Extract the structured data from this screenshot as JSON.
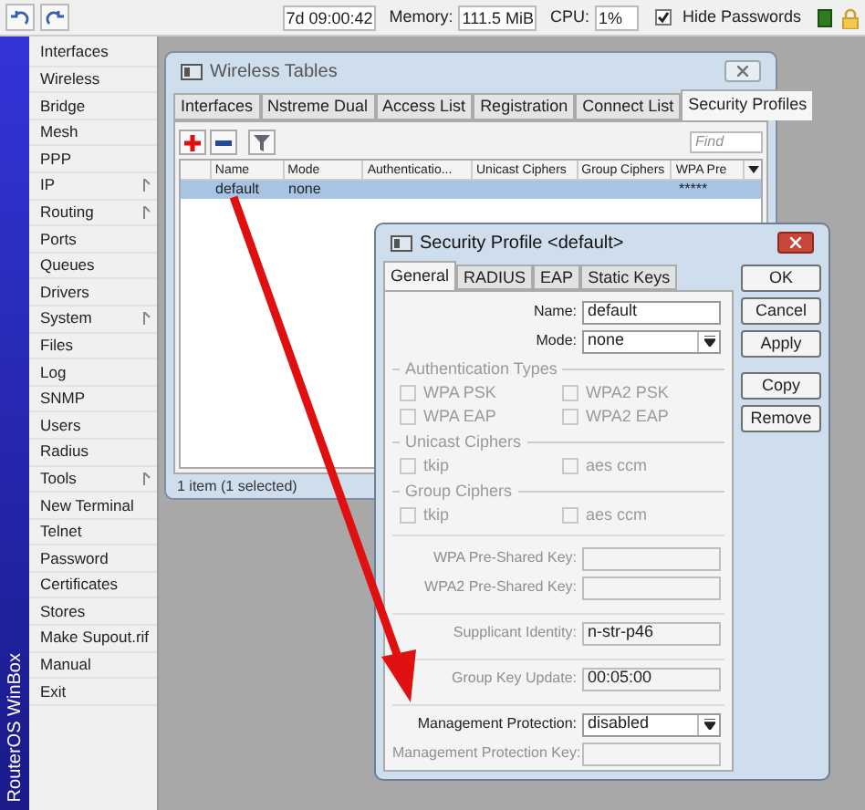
{
  "toolbar": {
    "uptime": "7d 09:00:42",
    "memory_label": "Memory:",
    "memory": "111.5 MiB",
    "cpu_label": "CPU:",
    "cpu": "1%",
    "hide_passwords": {
      "label": "Hide Passwords",
      "checked": true
    }
  },
  "sidebar": {
    "brand": "RouterOS WinBox",
    "items": [
      {
        "label": "Interfaces",
        "submenu": false
      },
      {
        "label": "Wireless",
        "submenu": false
      },
      {
        "label": "Bridge",
        "submenu": false
      },
      {
        "label": "Mesh",
        "submenu": false
      },
      {
        "label": "PPP",
        "submenu": false
      },
      {
        "label": "IP",
        "submenu": true
      },
      {
        "label": "Routing",
        "submenu": true
      },
      {
        "label": "Ports",
        "submenu": false
      },
      {
        "label": "Queues",
        "submenu": false
      },
      {
        "label": "Drivers",
        "submenu": false
      },
      {
        "label": "System",
        "submenu": true
      },
      {
        "label": "Files",
        "submenu": false
      },
      {
        "label": "Log",
        "submenu": false
      },
      {
        "label": "SNMP",
        "submenu": false
      },
      {
        "label": "Users",
        "submenu": false
      },
      {
        "label": "Radius",
        "submenu": false
      },
      {
        "label": "Tools",
        "submenu": true
      },
      {
        "label": "New Terminal",
        "submenu": false
      },
      {
        "label": "Telnet",
        "submenu": false
      },
      {
        "label": "Password",
        "submenu": false
      },
      {
        "label": "Certificates",
        "submenu": false
      },
      {
        "label": "Stores",
        "submenu": false
      },
      {
        "label": "Make Supout.rif",
        "submenu": false
      },
      {
        "label": "Manual",
        "submenu": false
      },
      {
        "label": "Exit",
        "submenu": false
      }
    ]
  },
  "wireless_tables": {
    "title": "Wireless Tables",
    "tabs": [
      {
        "label": "Interfaces",
        "selected": false
      },
      {
        "label": "Nstreme Dual",
        "selected": false
      },
      {
        "label": "Access List",
        "selected": false
      },
      {
        "label": "Registration",
        "selected": false
      },
      {
        "label": "Connect List",
        "selected": false
      },
      {
        "label": "Security Profiles",
        "selected": true
      }
    ],
    "find": {
      "placeholder": "Find"
    },
    "columns": [
      "Name",
      "Mode",
      "Authenticatio...",
      "Unicast Ciphers",
      "Group Ciphers",
      "WPA Pre"
    ],
    "rows": [
      {
        "cells": [
          "default",
          "none",
          "",
          "",
          "",
          "*****"
        ],
        "selected": true
      }
    ],
    "status": "1 item (1 selected)"
  },
  "security_profile": {
    "title": "Security Profile <default>",
    "tabs": [
      {
        "label": "General",
        "selected": true
      },
      {
        "label": "RADIUS",
        "selected": false
      },
      {
        "label": "EAP",
        "selected": false
      },
      {
        "label": "Static Keys",
        "selected": false
      }
    ],
    "top_fields": [
      {
        "label": "Name:",
        "value": "default",
        "kind": "text",
        "disabled": false
      },
      {
        "label": "Mode:",
        "value": "none",
        "kind": "dropdown",
        "disabled": false
      }
    ],
    "groups": [
      {
        "title": "Authentication Types",
        "checkboxes": [
          {
            "label": "WPA PSK",
            "checked": false,
            "disabled": true
          },
          {
            "label": "WPA2 PSK",
            "checked": false,
            "disabled": true
          },
          {
            "label": "WPA EAP",
            "checked": false,
            "disabled": true
          },
          {
            "label": "WPA2 EAP",
            "checked": false,
            "disabled": true
          }
        ]
      },
      {
        "title": "Unicast Ciphers",
        "checkboxes": [
          {
            "label": "tkip",
            "checked": false,
            "disabled": true
          },
          {
            "label": "aes ccm",
            "checked": false,
            "disabled": true
          }
        ]
      },
      {
        "title": "Group Ciphers",
        "checkboxes": [
          {
            "label": "tkip",
            "checked": false,
            "disabled": true
          },
          {
            "label": "aes ccm",
            "checked": false,
            "disabled": true
          }
        ]
      }
    ],
    "fields": [
      {
        "label": "WPA Pre-Shared Key:",
        "kind": "text",
        "disabled": true,
        "gap": false
      },
      {
        "label": "WPA2 Pre-Shared Key:",
        "kind": "text",
        "disabled": true,
        "gap": false
      },
      {
        "label": "Supplicant Identity:",
        "value": "n-str-p46",
        "kind": "text",
        "disabled": true,
        "gap": true
      },
      {
        "label": "Group Key Update:",
        "value": "00:05:00",
        "kind": "text",
        "disabled": true,
        "gap": true
      },
      {
        "label": "Management Protection:",
        "value": "disabled",
        "kind": "dropdown",
        "disabled": false,
        "gap": true
      },
      {
        "label": "Management Protection Key:",
        "kind": "text",
        "disabled": true,
        "gap": false
      }
    ],
    "button_groups": [
      [
        "OK",
        "Cancel",
        "Apply"
      ],
      [
        "Copy",
        "Remove"
      ]
    ]
  }
}
